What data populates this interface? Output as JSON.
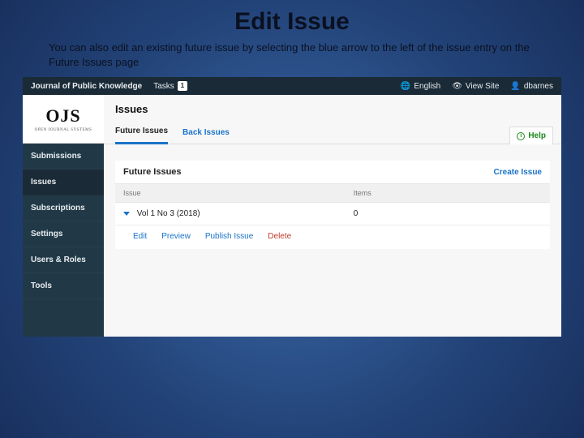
{
  "slide": {
    "title": "Edit Issue",
    "description": "You can also edit an existing future issue by selecting the blue arrow to the left of the issue entry on the Future Issues page"
  },
  "topbar": {
    "journal": "Journal of Public Knowledge",
    "tasks_label": "Tasks",
    "tasks_count": "1",
    "language": "English",
    "view_site": "View Site",
    "user": "dbarnes"
  },
  "logo": {
    "text": "OJS",
    "sub": "OPEN JOURNAL SYSTEMS"
  },
  "sidebar": {
    "items": [
      {
        "label": "Submissions"
      },
      {
        "label": "Issues"
      },
      {
        "label": "Subscriptions"
      },
      {
        "label": "Settings"
      },
      {
        "label": "Users & Roles"
      },
      {
        "label": "Tools"
      }
    ]
  },
  "main": {
    "heading": "Issues",
    "tabs": {
      "future": "Future Issues",
      "back": "Back Issues"
    },
    "help": "Help",
    "panel": {
      "title": "Future Issues",
      "create": "Create Issue",
      "cols": {
        "issue": "Issue",
        "items": "Items"
      },
      "row": {
        "title": "Vol 1 No 3 (2018)",
        "items": "0"
      },
      "actions": {
        "edit": "Edit",
        "preview": "Preview",
        "publish": "Publish Issue",
        "delete": "Delete"
      }
    }
  }
}
